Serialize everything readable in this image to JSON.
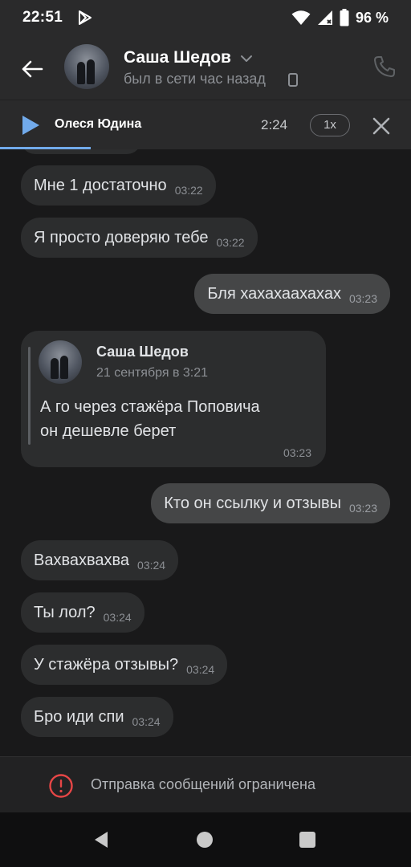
{
  "status_bar": {
    "time": "22:51",
    "battery_percent": "96 %"
  },
  "header": {
    "contact_name": "Саша Шедов",
    "last_seen": "был в сети час назад"
  },
  "player": {
    "title": "Олеся Юдина",
    "time": "2:24",
    "speed": "1x",
    "progress": 0.22
  },
  "messages": [
    {
      "text": "Мне 1 достаточно",
      "time": "03:22",
      "direction": "in"
    },
    {
      "text": "Я просто доверяю тебе",
      "time": "03:22",
      "direction": "in"
    },
    {
      "text": "Бля хахахаахахах",
      "time": "03:23",
      "direction": "out"
    },
    {
      "text": "Кто он ссылку и отзывы",
      "time": "03:23",
      "direction": "out"
    },
    {
      "text": "Вахвахвахва",
      "time": "03:24",
      "direction": "in"
    },
    {
      "text": "Ты лол?",
      "time": "03:24",
      "direction": "in"
    },
    {
      "text": "У стажёра отзывы?",
      "time": "03:24",
      "direction": "in"
    },
    {
      "text": "Бро иди спи",
      "time": "03:24",
      "direction": "in"
    }
  ],
  "forwarded": {
    "author": "Саша Шедов",
    "date": "21 сентября в 3:21",
    "text_line1": "А го через стажёра Поповича",
    "text_line2": "он дешевле берет",
    "time": "03:23"
  },
  "restriction": {
    "text": "Отправка сообщений ограничена"
  },
  "colors": {
    "background": "#19191a",
    "header": "#2a2a2b",
    "accent": "#71aaeb",
    "incoming_bubble": "#2c2d2e",
    "outgoing_bubble": "#454647",
    "warning": "#e64646"
  }
}
